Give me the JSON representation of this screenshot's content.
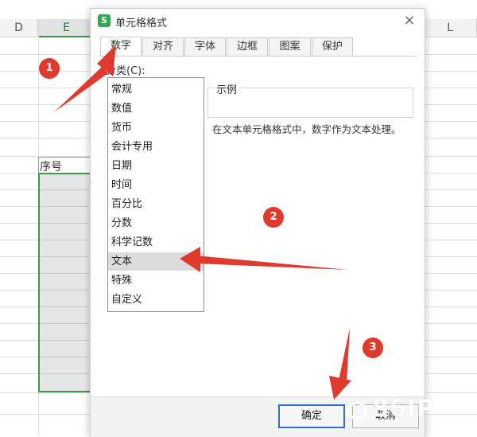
{
  "spreadsheet": {
    "columns": [
      "D",
      "E",
      "L"
    ],
    "selected_column": "E",
    "header_cell_text": "序号"
  },
  "dialog": {
    "app_icon": "S",
    "title": "单元格格式",
    "close_icon": "×",
    "tabs": [
      {
        "label": "数字",
        "active": true
      },
      {
        "label": "对齐",
        "active": false
      },
      {
        "label": "字体",
        "active": false
      },
      {
        "label": "边框",
        "active": false
      },
      {
        "label": "图案",
        "active": false
      },
      {
        "label": "保护",
        "active": false
      }
    ],
    "category_label": "分类(C):",
    "categories": [
      "常规",
      "数值",
      "货币",
      "会计专用",
      "日期",
      "时间",
      "百分比",
      "分数",
      "科学记数",
      "文本",
      "特殊",
      "自定义"
    ],
    "selected_category": "文本",
    "sample_label": "示例",
    "description": "在文本单元格格式中，数字作为文本处理。",
    "ok_label": "确定",
    "cancel_label": "取消"
  },
  "annotations": {
    "steps": [
      "1",
      "2",
      "3"
    ],
    "color": "#e03a2e"
  },
  "watermark": {
    "text": "86IP"
  },
  "colors": {
    "accent_green": "#3a9b4c",
    "primary_button_border": "#2e6ec4",
    "selection_fill": "#dcdcdc"
  }
}
